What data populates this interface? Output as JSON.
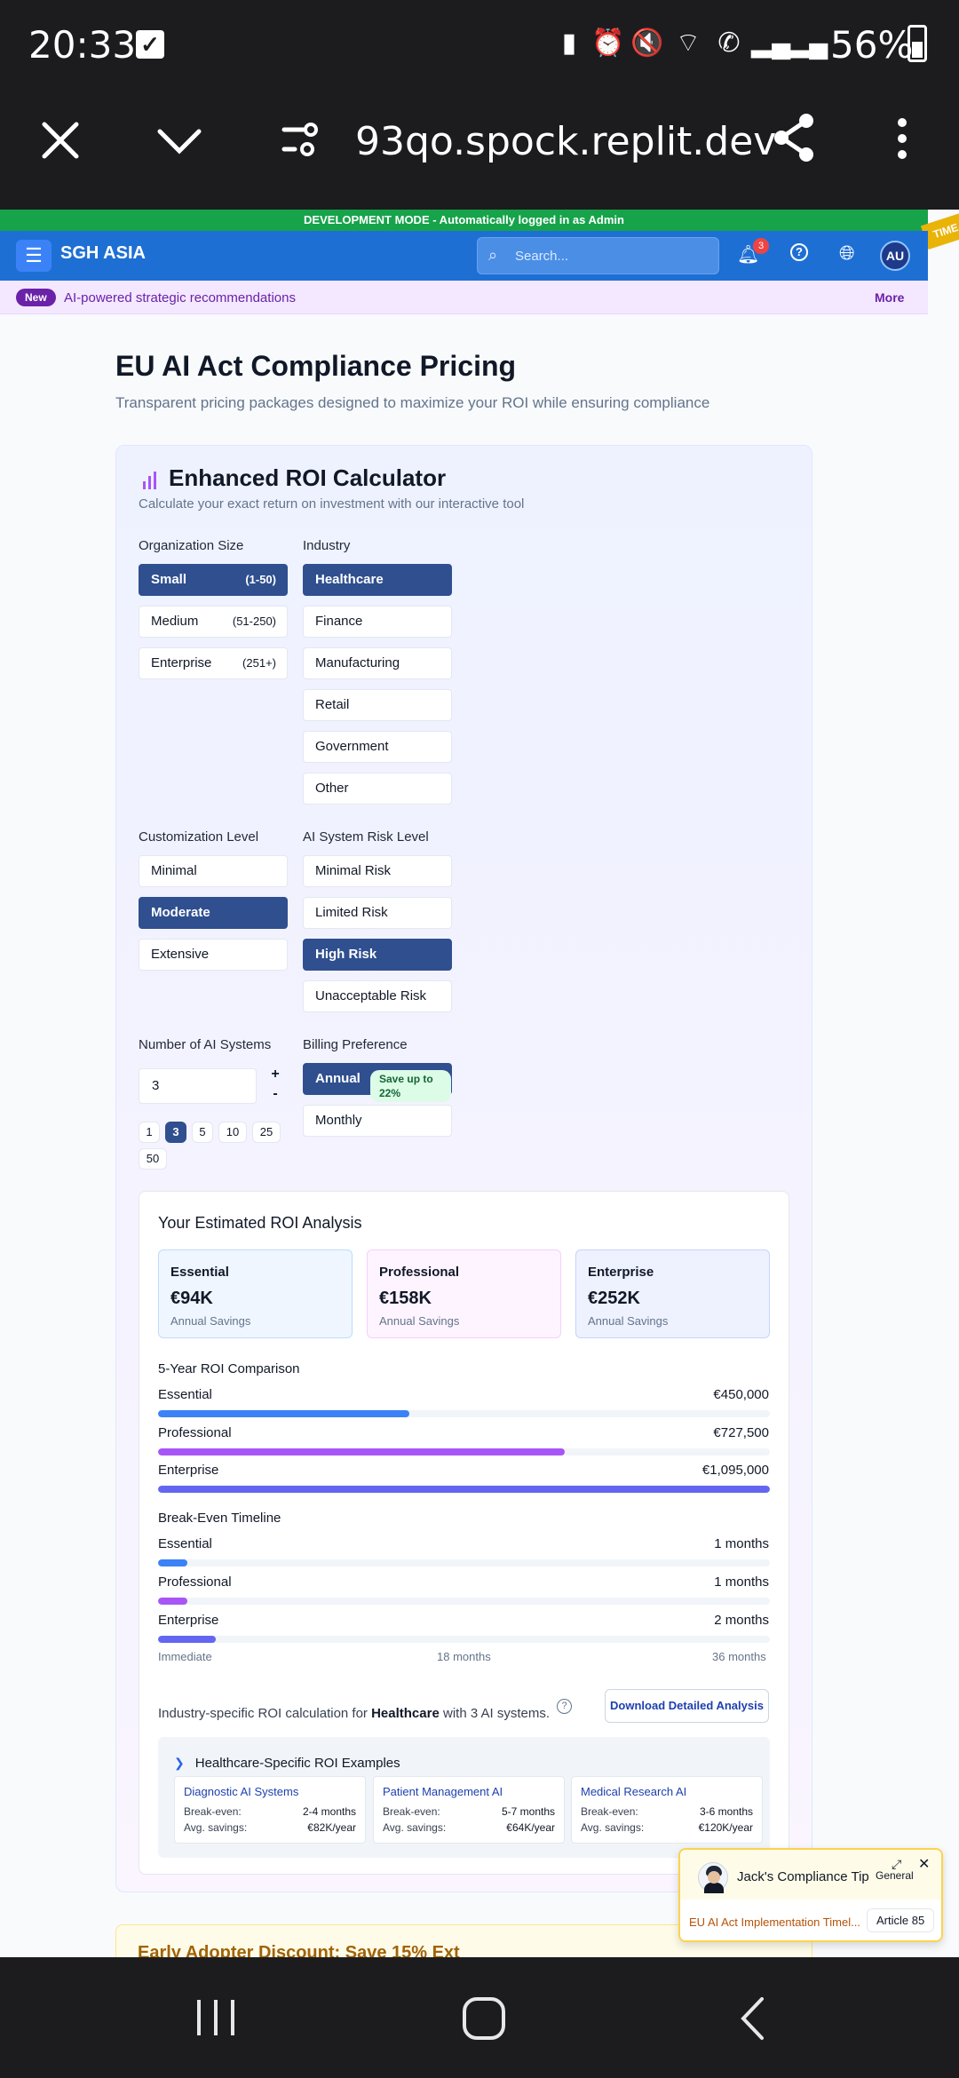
{
  "status_bar": {
    "time": "20:33",
    "battery": "56%"
  },
  "browser": {
    "url": "93qo.spock.replit.dev"
  },
  "dev_banner": "DEVELOPMENT MODE - Automatically logged in as Admin",
  "corner_tag": "TIME",
  "app": {
    "brand": "SGH ASIA",
    "search_placeholder": "Search...",
    "notifications": "3",
    "avatar": "AU"
  },
  "promo": {
    "badge": "New",
    "text": "AI-powered strategic recommendations",
    "more": "More"
  },
  "page": {
    "title": "EU AI Act Compliance Pricing",
    "subtitle": "Transparent pricing packages designed to maximize your ROI while ensuring compliance"
  },
  "calculator": {
    "title": "Enhanced ROI Calculator",
    "subtitle": "Calculate your exact return on investment with our interactive tool",
    "org_size": {
      "label": "Organization Size",
      "options": [
        {
          "name": "Small",
          "range": "(1-50)",
          "selected": true
        },
        {
          "name": "Medium",
          "range": "(51-250)",
          "selected": false
        },
        {
          "name": "Enterprise",
          "range": "(251+)",
          "selected": false
        }
      ]
    },
    "industry": {
      "label": "Industry",
      "options": [
        {
          "name": "Healthcare",
          "selected": true
        },
        {
          "name": "Finance",
          "selected": false
        },
        {
          "name": "Manufacturing",
          "selected": false
        },
        {
          "name": "Retail",
          "selected": false
        },
        {
          "name": "Government",
          "selected": false
        },
        {
          "name": "Other",
          "selected": false
        }
      ]
    },
    "customization": {
      "label": "Customization Level",
      "options": [
        {
          "name": "Minimal",
          "selected": false
        },
        {
          "name": "Moderate",
          "selected": true
        },
        {
          "name": "Extensive",
          "selected": false
        }
      ]
    },
    "risk": {
      "label": "AI System Risk Level",
      "options": [
        {
          "name": "Minimal Risk",
          "selected": false
        },
        {
          "name": "Limited Risk",
          "selected": false
        },
        {
          "name": "High Risk",
          "selected": true
        },
        {
          "name": "Unacceptable Risk",
          "selected": false
        }
      ]
    },
    "systems": {
      "label": "Number of AI Systems",
      "value": "3",
      "plus": "+",
      "minus": "-",
      "presets": [
        "1",
        "3",
        "5",
        "10",
        "25",
        "50"
      ],
      "selected": "3"
    },
    "billing": {
      "label": "Billing Preference",
      "annual": "Annual",
      "save": "Save up to 22%",
      "monthly": "Monthly"
    }
  },
  "roi": {
    "title": "Your Estimated ROI Analysis",
    "packages": [
      {
        "name": "Essential",
        "value": "€94K",
        "caption": "Annual Savings",
        "bg": "#eff6ff",
        "border": "#bfdbfe"
      },
      {
        "name": "Professional",
        "value": "€158K",
        "caption": "Annual Savings",
        "bg": "#fdf4ff",
        "border": "#f5d0fe"
      },
      {
        "name": "Enterprise",
        "value": "€252K",
        "caption": "Annual Savings",
        "bg": "#eef2ff",
        "border": "#c7d2fe"
      }
    ],
    "five_year": {
      "title": "5-Year ROI Comparison",
      "max": 1095000,
      "bars": [
        {
          "name": "Essential",
          "label": "€450,000",
          "value": 450000,
          "color": "#3b82f6"
        },
        {
          "name": "Professional",
          "label": "€727,500",
          "value": 727500,
          "color": "#a855f7"
        },
        {
          "name": "Enterprise",
          "label": "€1,095,000",
          "value": 1095000,
          "color": "#6366f1"
        }
      ]
    },
    "break_even": {
      "title": "Break-Even Timeline",
      "max": 36,
      "bars": [
        {
          "name": "Essential",
          "label": "1 months",
          "value": 1,
          "color": "#3b82f6"
        },
        {
          "name": "Professional",
          "label": "1 months",
          "value": 1,
          "color": "#a855f7"
        },
        {
          "name": "Enterprise",
          "label": "2 months",
          "value": 2,
          "color": "#6366f1"
        }
      ],
      "axis": [
        "Immediate",
        "18 months",
        "36 months"
      ]
    },
    "industry_note": {
      "pre": "Industry-specific ROI calculation for ",
      "industry": "Healthcare",
      "post": " with 3 AI systems."
    },
    "download": "Download Detailed Analysis",
    "examples": {
      "title": "Healthcare-Specific ROI Examples",
      "items": [
        {
          "title": "Diagnostic AI Systems",
          "breakeven": "2-4 months",
          "savings": "€82K/year"
        },
        {
          "title": "Patient Management AI",
          "breakeven": "5-7 months",
          "savings": "€64K/year"
        },
        {
          "title": "Medical Research AI",
          "breakeven": "3-6 months",
          "savings": "€120K/year"
        }
      ],
      "breakeven_key": "Break-even:",
      "savings_key": "Avg. savings:"
    }
  },
  "early_adopter": "Early Adopter Discount: Save 15% Ext",
  "tip": {
    "name": "Jack's Compliance Tip",
    "tag": "General",
    "article": "EU AI Act Implementation Timel...",
    "badge": "Article 85"
  },
  "colors": {
    "primary": "#1e6fd4",
    "selected": "#2f4f8f",
    "dev": "#16a34a",
    "promo": "#6b21a8"
  }
}
